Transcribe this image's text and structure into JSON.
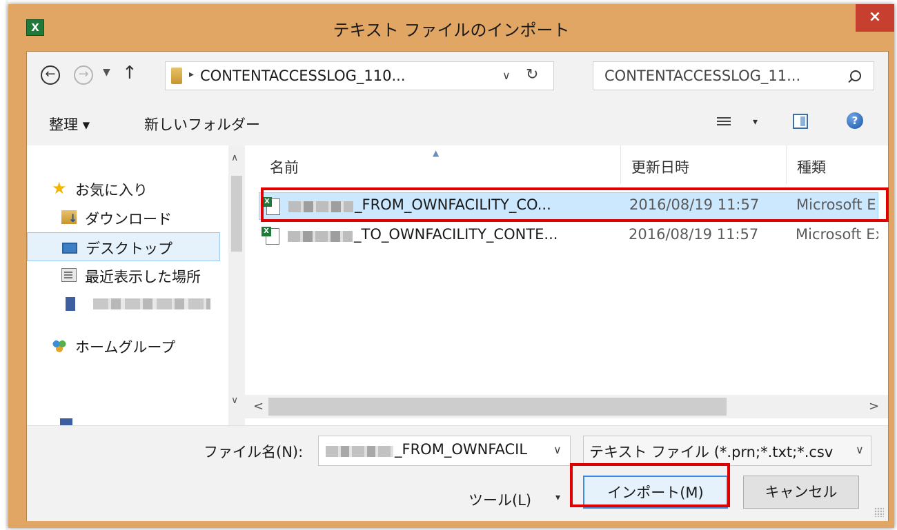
{
  "window": {
    "title": "テキスト ファイルのインポート",
    "app_icon": "excel-icon",
    "close_label": "×"
  },
  "address_bar": {
    "back_glyph": "←",
    "forward_glyph": "→",
    "path_text": "CONTENTACCESSLOG_110...",
    "search_placeholder": "CONTENTACCESSLOG_11..."
  },
  "toolbar": {
    "organize_label": "整理 ▾",
    "new_folder_label": "新しいフォルダー",
    "view_dropdown": "▾",
    "help_label": "?"
  },
  "nav_pane": {
    "items": [
      {
        "label": "お気に入り",
        "icon": "star-icon"
      },
      {
        "label": "ダウンロード",
        "icon": "download-folder-icon"
      },
      {
        "label": "デスクトップ",
        "icon": "desktop-icon",
        "selected": true
      },
      {
        "label": "最近表示した場所",
        "icon": "recent-places-icon"
      },
      {
        "label": "",
        "icon": "computer-icon",
        "redacted": true
      },
      {
        "label": "ホームグループ",
        "icon": "homegroup-icon"
      }
    ]
  },
  "file_list": {
    "columns": [
      "名前",
      "更新日時",
      "種類"
    ],
    "rows": [
      {
        "name_suffix": "_FROM_OWNFACILITY_CO...",
        "modified": "2016/08/19 11:57",
        "type": "Microsoft E",
        "selected": true,
        "name_prefix_redacted": true
      },
      {
        "name_suffix": "_TO_OWNFACILITY_CONTE...",
        "modified": "2016/08/19 11:57",
        "type": "Microsoft Ex",
        "selected": false,
        "name_prefix_redacted": true
      }
    ]
  },
  "bottom": {
    "filename_label": "ファイル名(N):",
    "filename_value_suffix": "_FROM_OWNFACIL",
    "filetype_value": "テキスト ファイル (*.prn;*.txt;*.csv",
    "tools_label": "ツール(L)",
    "tools_dropdown": "▾",
    "import_label": "インポート(M)",
    "cancel_label": "キャンセル"
  },
  "colors": {
    "window_frame": "#e2a664",
    "close_button": "#c7402f",
    "selection": "#cce8ff",
    "annotation_red": "#e00000"
  }
}
